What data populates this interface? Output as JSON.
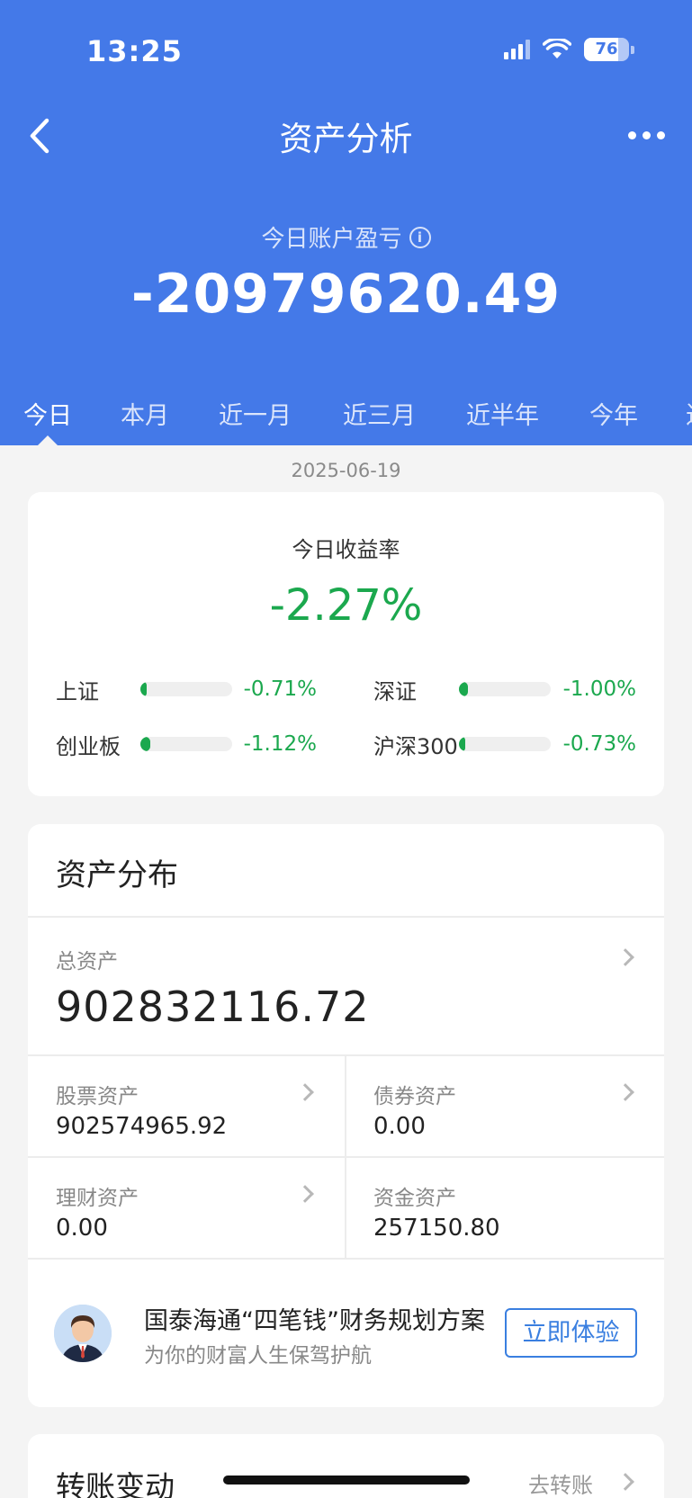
{
  "status_bar": {
    "time": "13:25",
    "battery": "76",
    "battery_level": 0.76
  },
  "header": {
    "title": "资产分析"
  },
  "icons": {
    "back": "chevron-left-icon",
    "more": "more-dots-icon",
    "info": "info-icon",
    "signal": "signal-icon",
    "wifi": "wifi-icon",
    "battery": "battery-icon",
    "chevron": "chevron-right-icon",
    "avatar": "advisor-avatar-icon"
  },
  "profit_loss": {
    "label": "今日账户盈亏",
    "value": "-20979620.49"
  },
  "tabs": [
    "今日",
    "本月",
    "近一月",
    "近三月",
    "近半年",
    "今年",
    "近"
  ],
  "date": "2025-06-19",
  "return_card": {
    "title": "今日收益率",
    "value": "-2.27%",
    "indices": [
      {
        "name": "上证",
        "value": "-0.71%",
        "level": 0.071
      },
      {
        "name": "深证",
        "value": "-1.00%",
        "level": 0.1
      },
      {
        "name": "创业板",
        "value": "-1.12%",
        "level": 0.112
      },
      {
        "name": "沪深300",
        "value": "-0.73%",
        "level": 0.073
      }
    ]
  },
  "assets": {
    "title": "资产分布",
    "total_label": "总资产",
    "total_value": "902832116.72",
    "items": [
      {
        "label": "股票资产",
        "value": "902574965.92"
      },
      {
        "label": "债券资产",
        "value": "0.00"
      },
      {
        "label": "理财资产",
        "value": "0.00"
      },
      {
        "label": "资金资产",
        "value": "257150.80"
      }
    ]
  },
  "promo": {
    "title": "国泰海通“四笔钱”财务规划方案",
    "subtitle": "为你的财富人生保驾护航",
    "button": "立即体验"
  },
  "transfer": {
    "title": "转账变动",
    "link": "去转账"
  },
  "colors": {
    "primary": "#4479e8",
    "loss": "#1ba84e",
    "button": "#3a7fe0"
  }
}
